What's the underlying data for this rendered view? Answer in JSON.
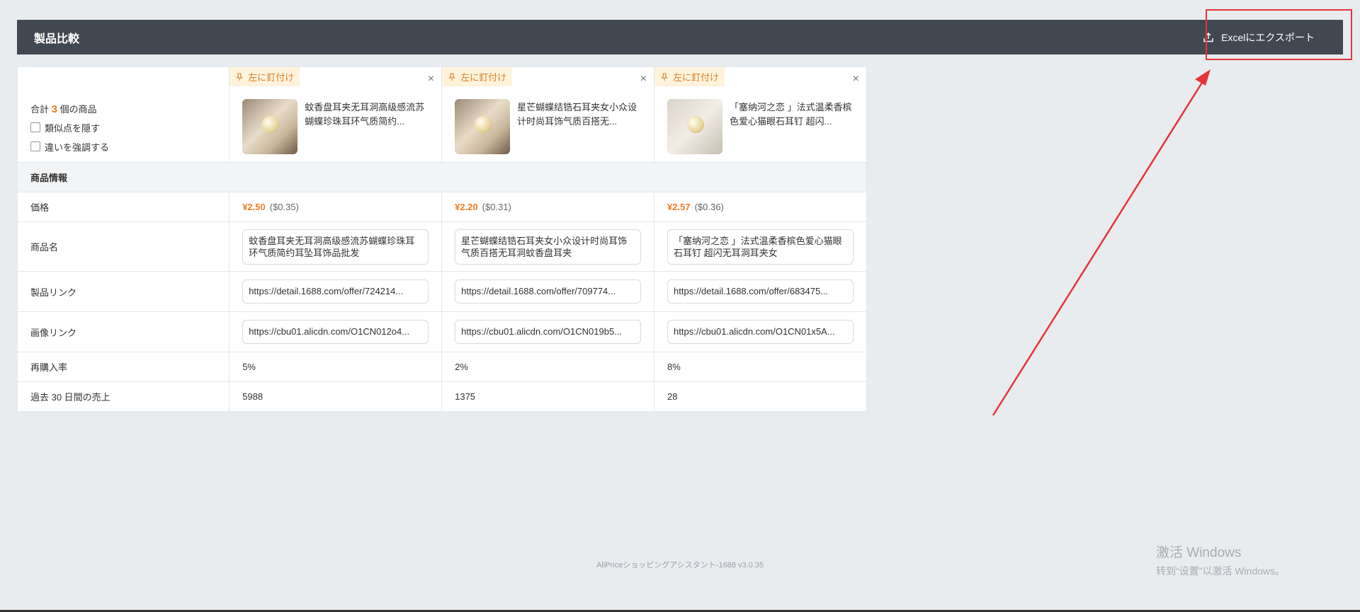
{
  "header": {
    "title": "製品比較",
    "export_label": "Excelにエクスポート"
  },
  "summary": {
    "total_prefix": "合計",
    "total_count": "3",
    "total_suffix": "個の商品",
    "hide_similar": "類似点を隠す",
    "highlight_diff": "違いを強調する"
  },
  "pin_label": "左に釘付け",
  "close_glyph": "×",
  "products": [
    {
      "title": "蚊香盘耳夹无耳洞高级感流苏蝴蝶珍珠耳环气质简约...",
      "price": "¥2.50",
      "usd": "($0.35)",
      "name": "蚊香盘耳夹无耳洞高级感流苏蝴蝶珍珠耳环气质简约耳坠耳饰品批发",
      "link": "https://detail.1688.com/offer/724214...",
      "image_link": "https://cbu01.alicdn.com/O1CN012o4...",
      "repurchase": "5%",
      "sales": "5988"
    },
    {
      "title": "星芒蝴蝶结锆石耳夹女小众设计时尚耳饰气质百搭无...",
      "price": "¥2.20",
      "usd": "($0.31)",
      "name": "星芒蝴蝶结锆石耳夹女小众设计时尚耳饰气质百搭无耳洞蚊香盘耳夹",
      "link": "https://detail.1688.com/offer/709774...",
      "image_link": "https://cbu01.alicdn.com/O1CN019b5...",
      "repurchase": "2%",
      "sales": "1375"
    },
    {
      "title": "「塞纳河之恋 」法式温柔香槟色爱心猫眼石耳钉 超闪...",
      "price": "¥2.57",
      "usd": "($0.36)",
      "name": "「塞纳河之恋 」法式温柔香槟色爱心猫眼石耳钉 超闪无耳洞耳夹女",
      "link": "https://detail.1688.com/offer/683475...",
      "image_link": "https://cbu01.alicdn.com/O1CN01x5A...",
      "repurchase": "8%",
      "sales": "28"
    }
  ],
  "rows": {
    "section": "商品情報",
    "price": "価格",
    "name": "商品名",
    "link": "製品リンク",
    "image_link": "画像リンク",
    "repurchase": "再購入率",
    "sales": "過去 30 日間の売上"
  },
  "footer": "AliPriceショッピングアシスタント-1688 v3.0.35",
  "watermark": {
    "line1": "激活 Windows",
    "line2": "转到“设置”以激活 Windows。"
  },
  "colors": {
    "header_bg": "#424852",
    "accent": "#f47a1f",
    "annotation": "#e5343a"
  }
}
